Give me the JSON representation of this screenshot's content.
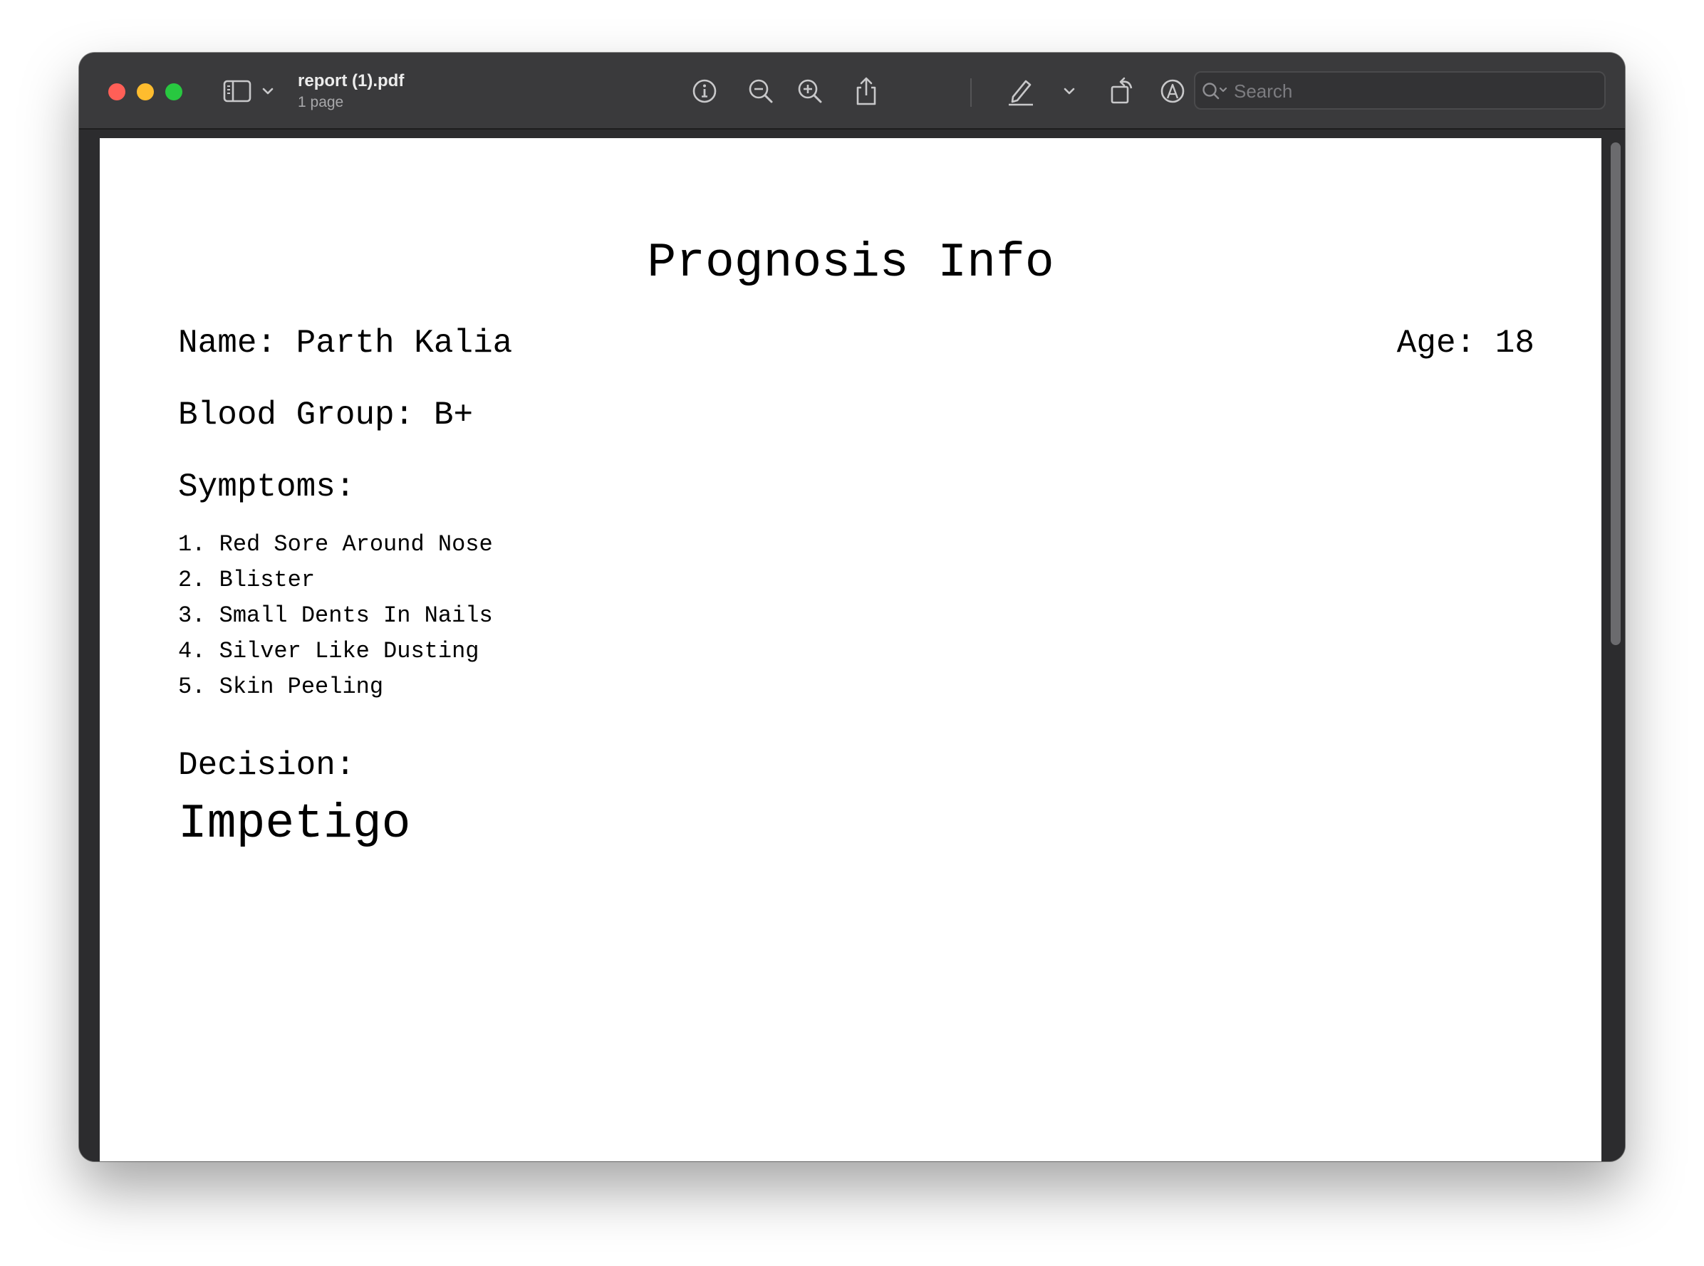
{
  "window": {
    "title": "report (1).pdf",
    "subtitle": "1 page"
  },
  "toolbar": {
    "icons": [
      "sidebar-icon",
      "chevron-down-icon",
      "info-icon",
      "zoom-out-icon",
      "zoom-in-icon",
      "share-icon",
      "highlight-pen-icon",
      "chevron-down-icon",
      "rotate-icon",
      "markup-icon",
      "signature-icon",
      "search-icon"
    ],
    "search_placeholder": "Search"
  },
  "document": {
    "heading": "Prognosis Info",
    "name": "Name: Parth Kalia",
    "age": "Age: 18",
    "blood_group": "Blood Group: B+",
    "symptoms_heading": "Symptoms:",
    "symptoms": [
      "1. Red Sore Around Nose",
      "2. Blister",
      "3. Small Dents In Nails",
      "4. Silver Like Dusting",
      "5. Skin Peeling"
    ],
    "decision_heading": "Decision:",
    "decision": "Impetigo"
  },
  "colors": {
    "close": "#ff5f57",
    "minimize": "#febc2e",
    "maximize": "#28c840",
    "titlebar": "#3a3a3c",
    "page": "#ffffff"
  }
}
